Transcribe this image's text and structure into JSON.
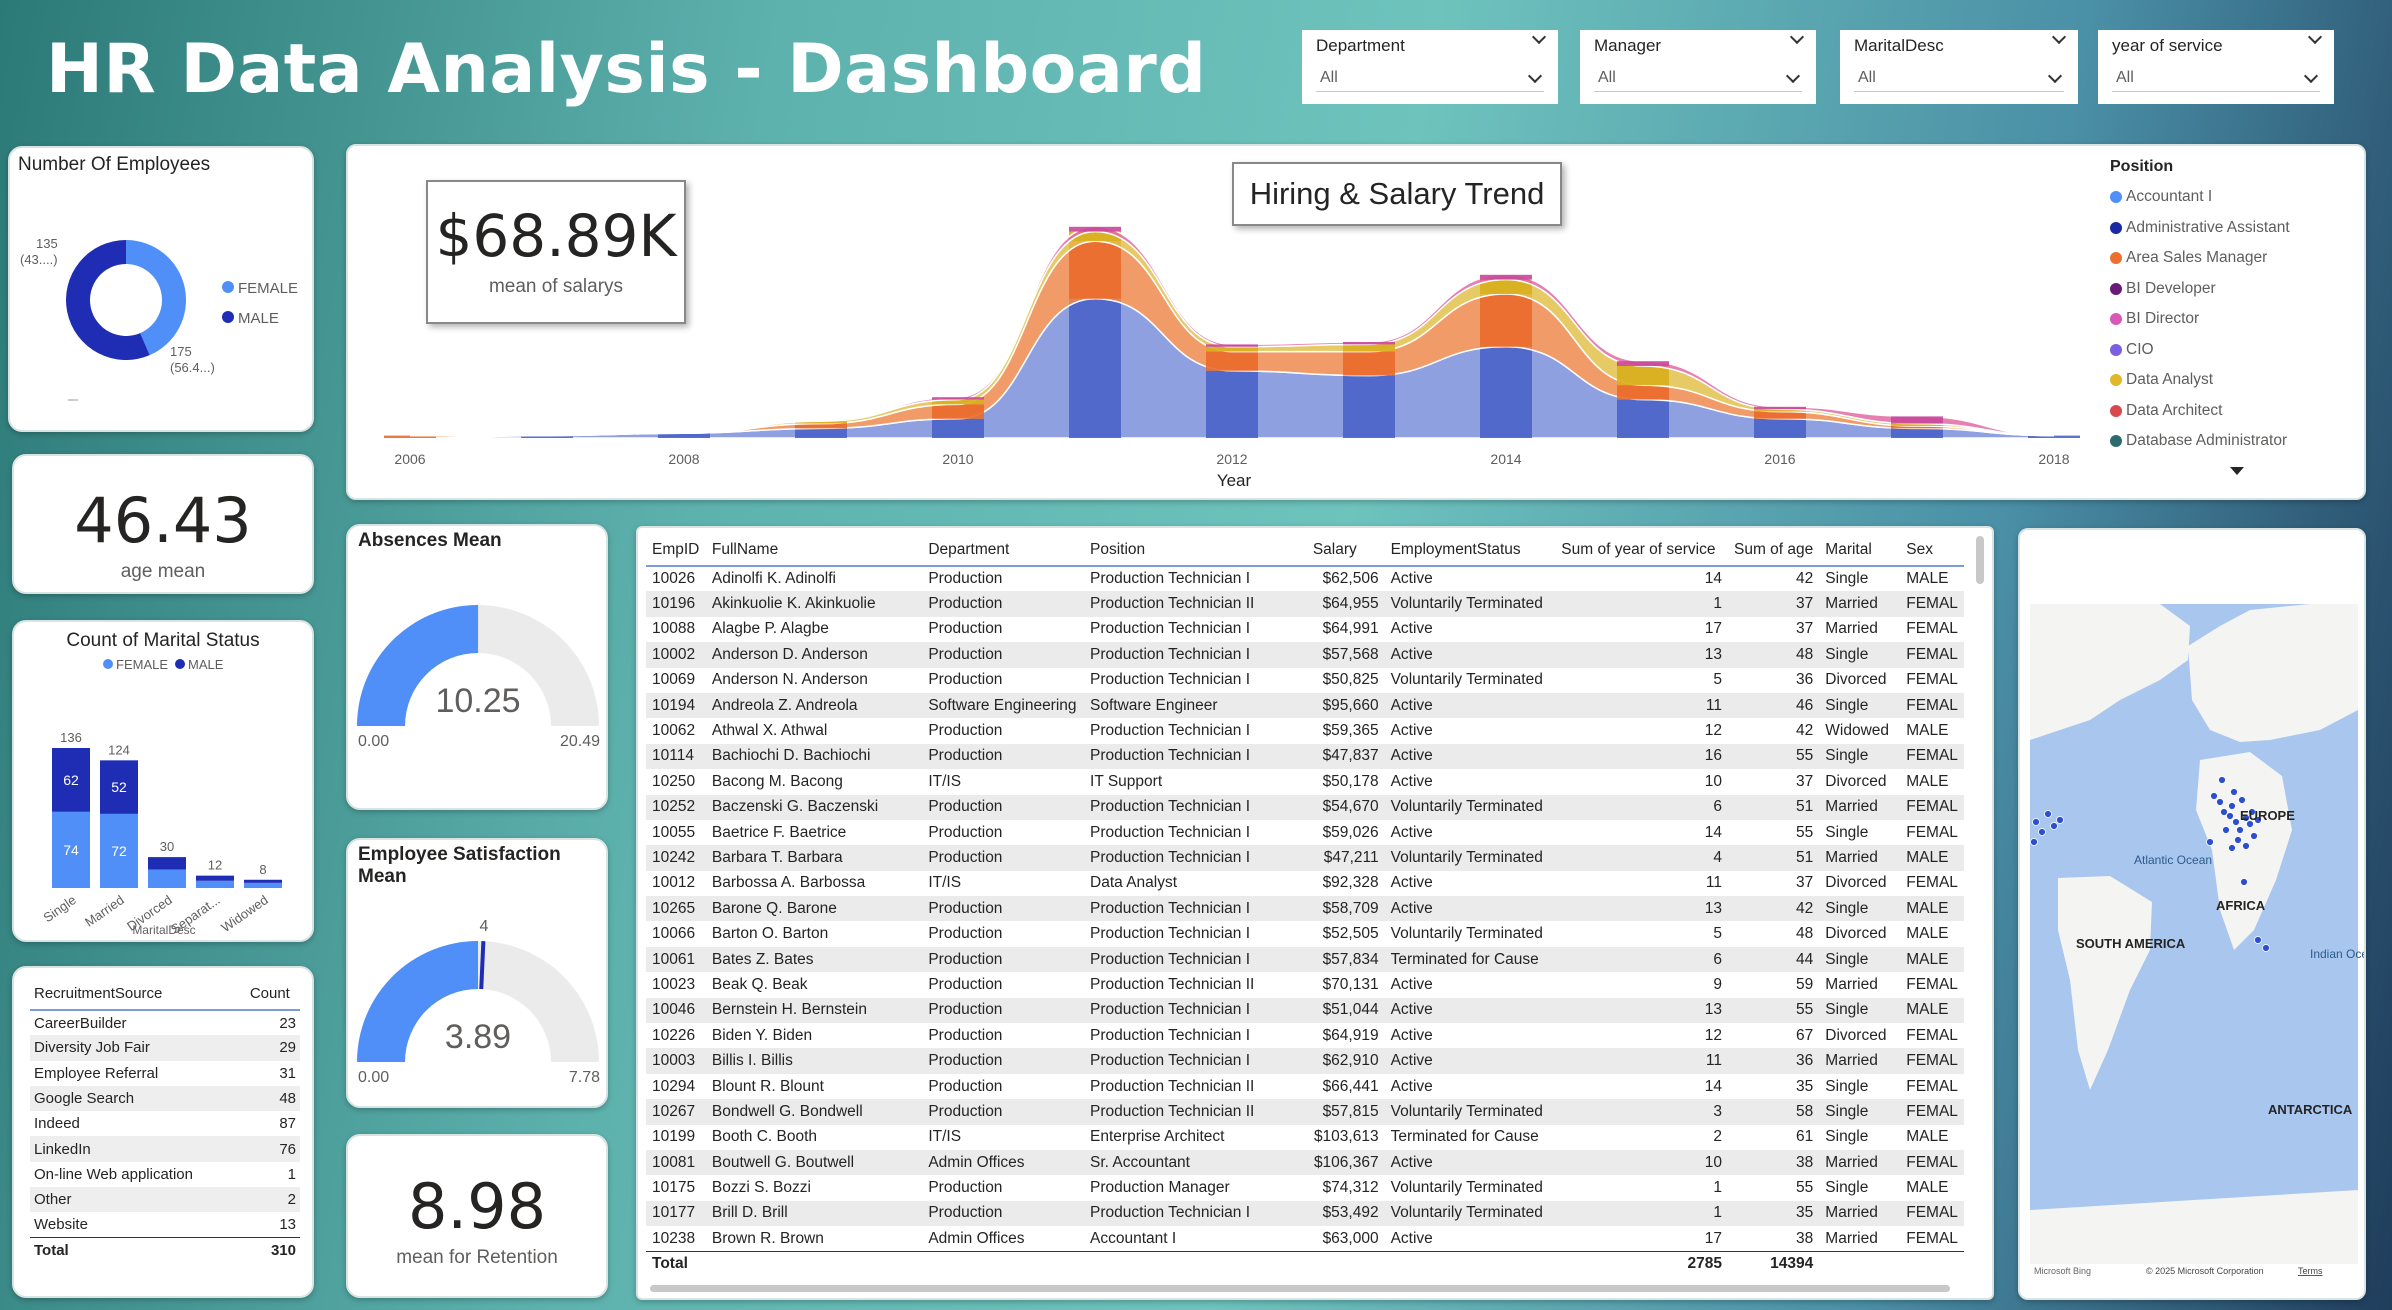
{
  "header": {
    "title": "HR Data Analysis - Dashboard"
  },
  "slicers": [
    {
      "label": "Department",
      "value": "All"
    },
    {
      "label": "Manager",
      "value": "All"
    },
    {
      "label": "MaritalDesc",
      "value": "All"
    },
    {
      "label": "year of service",
      "value": "All"
    }
  ],
  "employees": {
    "title": "Number Of Employees",
    "female_label": "135",
    "female_pct": "(43....)",
    "male_label": "175",
    "male_pct": "(56.4...)",
    "legend_female": "FEMALE",
    "legend_male": "MALE",
    "colors": {
      "female": "#4f8ff7",
      "male": "#1f2db5"
    }
  },
  "age": {
    "value": "46.43",
    "label": "age mean"
  },
  "marital": {
    "title": "Count of Marital Status",
    "legend_female": "FEMALE",
    "legend_male": "MALE",
    "xlabel": "MaritalDesc"
  },
  "recruitment": {
    "headers": [
      "RecruitmentSource",
      "Count"
    ],
    "rows": [
      [
        "CareerBuilder",
        "23"
      ],
      [
        "Diversity Job Fair",
        "29"
      ],
      [
        "Employee Referral",
        "31"
      ],
      [
        "Google Search",
        "48"
      ],
      [
        "Indeed",
        "87"
      ],
      [
        "LinkedIn",
        "76"
      ],
      [
        "On-line Web application",
        "1"
      ],
      [
        "Other",
        "2"
      ],
      [
        "Website",
        "13"
      ]
    ],
    "total_label": "Total",
    "total_value": "310"
  },
  "salary_kpi": {
    "value": "$68.89K",
    "label": "mean of salarys"
  },
  "trend": {
    "title": "Hiring & Salary Trend",
    "xlabel": "Year",
    "legend_title": "Position",
    "legend": [
      {
        "name": "Accountant I",
        "color": "#4f8ff7"
      },
      {
        "name": "Administrative Assistant",
        "color": "#1a2aa0"
      },
      {
        "name": "Area Sales Manager",
        "color": "#ec6f2e"
      },
      {
        "name": "BI Developer",
        "color": "#6a1b7a"
      },
      {
        "name": "BI Director",
        "color": "#d858b8"
      },
      {
        "name": "CIO",
        "color": "#7b5fe0"
      },
      {
        "name": "Data Analyst",
        "color": "#e0b82a"
      },
      {
        "name": "Data Architect",
        "color": "#d9484c"
      },
      {
        "name": "Database Administrator",
        "color": "#2e6b6e"
      }
    ]
  },
  "absences": {
    "title": "Absences Mean",
    "value": "10.25",
    "min": "0.00",
    "max": "20.49"
  },
  "satisfaction": {
    "title": "Employee Satisfaction Mean",
    "value": "3.89",
    "min": "0.00",
    "max": "7.78",
    "target": "4"
  },
  "retention": {
    "value": "8.98",
    "label": "mean for Retention"
  },
  "employee_table": {
    "headers": [
      "EmpID",
      "FullName",
      "Department",
      "Position",
      "Salary",
      "EmploymentStatus",
      "Sum of year of service",
      "Sum of age",
      "Marital",
      "Sex"
    ],
    "rows": [
      [
        "10026",
        "Adinolfi K. Adinolfi",
        "Production",
        "Production Technician I",
        "$62,506",
        "Active",
        "14",
        "42",
        "Single",
        "MALE"
      ],
      [
        "10196",
        "Akinkuolie K. Akinkuolie",
        "Production",
        "Production Technician II",
        "$64,955",
        "Voluntarily Terminated",
        "1",
        "37",
        "Married",
        "FEMAL"
      ],
      [
        "10088",
        "Alagbe P. Alagbe",
        "Production",
        "Production Technician I",
        "$64,991",
        "Active",
        "17",
        "37",
        "Married",
        "FEMAL"
      ],
      [
        "10002",
        "Anderson D. Anderson",
        "Production",
        "Production Technician I",
        "$57,568",
        "Active",
        "13",
        "48",
        "Single",
        "FEMAL"
      ],
      [
        "10069",
        "Anderson N. Anderson",
        "Production",
        "Production Technician I",
        "$50,825",
        "Voluntarily Terminated",
        "5",
        "36",
        "Divorced",
        "FEMAL"
      ],
      [
        "10194",
        "Andreola Z. Andreola",
        "Software Engineering",
        "Software Engineer",
        "$95,660",
        "Active",
        "11",
        "46",
        "Single",
        "FEMAL"
      ],
      [
        "10062",
        "Athwal X. Athwal",
        "Production",
        "Production Technician I",
        "$59,365",
        "Active",
        "12",
        "42",
        "Widowed",
        "MALE"
      ],
      [
        "10114",
        "Bachiochi D. Bachiochi",
        "Production",
        "Production Technician I",
        "$47,837",
        "Active",
        "16",
        "55",
        "Single",
        "FEMAL"
      ],
      [
        "10250",
        "Bacong M. Bacong",
        "IT/IS",
        "IT Support",
        "$50,178",
        "Active",
        "10",
        "37",
        "Divorced",
        "MALE"
      ],
      [
        "10252",
        "Baczenski G. Baczenski",
        "Production",
        "Production Technician I",
        "$54,670",
        "Voluntarily Terminated",
        "6",
        "51",
        "Married",
        "FEMAL"
      ],
      [
        "10055",
        "Baetrice F. Baetrice",
        "Production",
        "Production Technician I",
        "$59,026",
        "Active",
        "14",
        "55",
        "Single",
        "FEMAL"
      ],
      [
        "10242",
        "Barbara T. Barbara",
        "Production",
        "Production Technician I",
        "$47,211",
        "Voluntarily Terminated",
        "4",
        "51",
        "Married",
        "MALE"
      ],
      [
        "10012",
        "Barbossa A. Barbossa",
        "IT/IS",
        "Data Analyst",
        "$92,328",
        "Active",
        "11",
        "37",
        "Divorced",
        "FEMAL"
      ],
      [
        "10265",
        "Barone Q. Barone",
        "Production",
        "Production Technician I",
        "$58,709",
        "Active",
        "13",
        "42",
        "Single",
        "MALE"
      ],
      [
        "10066",
        "Barton O. Barton",
        "Production",
        "Production Technician I",
        "$52,505",
        "Voluntarily Terminated",
        "5",
        "48",
        "Divorced",
        "MALE"
      ],
      [
        "10061",
        "Bates Z. Bates",
        "Production",
        "Production Technician I",
        "$57,834",
        "Terminated for Cause",
        "6",
        "44",
        "Single",
        "MALE"
      ],
      [
        "10023",
        "Beak Q. Beak",
        "Production",
        "Production Technician II",
        "$70,131",
        "Active",
        "9",
        "59",
        "Married",
        "FEMAL"
      ],
      [
        "10046",
        "Bernstein H. Bernstein",
        "Production",
        "Production Technician I",
        "$51,044",
        "Active",
        "13",
        "55",
        "Single",
        "MALE"
      ],
      [
        "10226",
        "Biden Y. Biden",
        "Production",
        "Production Technician I",
        "$64,919",
        "Active",
        "12",
        "67",
        "Divorced",
        "FEMAL"
      ],
      [
        "10003",
        "Billis I. Billis",
        "Production",
        "Production Technician I",
        "$62,910",
        "Active",
        "11",
        "36",
        "Married",
        "FEMAL"
      ],
      [
        "10294",
        "Blount R. Blount",
        "Production",
        "Production Technician II",
        "$66,441",
        "Active",
        "14",
        "35",
        "Single",
        "FEMAL"
      ],
      [
        "10267",
        "Bondwell G. Bondwell",
        "Production",
        "Production Technician II",
        "$57,815",
        "Voluntarily Terminated",
        "3",
        "58",
        "Single",
        "FEMAL"
      ],
      [
        "10199",
        "Booth C. Booth",
        "IT/IS",
        "Enterprise Architect",
        "$103,613",
        "Terminated for Cause",
        "2",
        "61",
        "Single",
        "MALE"
      ],
      [
        "10081",
        "Boutwell G. Boutwell",
        "Admin Offices",
        "Sr. Accountant",
        "$106,367",
        "Active",
        "10",
        "38",
        "Married",
        "FEMAL"
      ],
      [
        "10175",
        "Bozzi S. Bozzi",
        "Production",
        "Production Manager",
        "$74,312",
        "Voluntarily Terminated",
        "1",
        "55",
        "Single",
        "MALE"
      ],
      [
        "10177",
        "Brill D. Brill",
        "Production",
        "Production Technician I",
        "$53,492",
        "Voluntarily Terminated",
        "1",
        "35",
        "Married",
        "FEMAL"
      ],
      [
        "10238",
        "Brown R. Brown",
        "Admin Offices",
        "Accountant I",
        "$63,000",
        "Active",
        "17",
        "38",
        "Married",
        "FEMAL"
      ]
    ],
    "total_label": "Total",
    "total_service": "2785",
    "total_age": "14394"
  },
  "map": {
    "labels": {
      "europe": "EUROPE",
      "atlantic": "Atlantic Ocean",
      "africa": "AFRICA",
      "south_america": "SOUTH AMERICA",
      "indian": "Indian Ocean",
      "antarctica": "ANTARCTICA"
    },
    "footer_brand": "Microsoft Bing",
    "copyright": "© 2025 Microsoft Corporation",
    "terms": "Terms"
  },
  "chart_data": [
    {
      "type": "pie",
      "title": "Number Of Employees",
      "categories": [
        "FEMALE",
        "MALE"
      ],
      "values": [
        135,
        175
      ]
    },
    {
      "type": "bar",
      "title": "Count of Marital Status",
      "xlabel": "MaritalDesc",
      "categories": [
        "Single",
        "Married",
        "Divorced",
        "Separat...",
        "Widowed"
      ],
      "totals": [
        136,
        124,
        30,
        12,
        8
      ],
      "series": [
        {
          "name": "FEMALE",
          "values": [
            74,
            72,
            18,
            7,
            5
          ],
          "color": "#4f8ff7"
        },
        {
          "name": "MALE",
          "values": [
            62,
            52,
            12,
            5,
            3
          ],
          "color": "#1f2db5"
        }
      ]
    },
    {
      "type": "area",
      "title": "Hiring & Salary Trend",
      "xlabel": "Year",
      "x_ticks": [
        "2006",
        "2008",
        "2010",
        "2012",
        "2014",
        "2016",
        "2018"
      ],
      "x": [
        2006,
        2007,
        2008,
        2009,
        2010,
        2011,
        2012,
        2013,
        2014,
        2015,
        2016,
        2017,
        2018
      ],
      "series": [
        {
          "name": "Accountant I",
          "values": [
            0,
            1,
            2,
            4,
            8,
            58,
            28,
            26,
            38,
            16,
            8,
            4,
            1
          ]
        },
        {
          "name": "Area Sales Manager",
          "values": [
            1,
            0,
            0,
            2,
            6,
            24,
            8,
            10,
            22,
            6,
            3,
            1,
            0
          ]
        },
        {
          "name": "Data Analyst",
          "values": [
            0,
            0,
            0,
            1,
            2,
            4,
            2,
            3,
            6,
            8,
            1,
            1,
            0
          ]
        },
        {
          "name": "BI Director",
          "values": [
            0,
            0,
            0,
            0,
            1,
            2,
            1,
            1,
            2,
            2,
            1,
            3,
            0
          ]
        }
      ]
    },
    {
      "type": "gauge",
      "title": "Absences Mean",
      "value": 10.25,
      "min": 0.0,
      "max": 20.49
    },
    {
      "type": "gauge",
      "title": "Employee Satisfaction Mean",
      "value": 3.89,
      "min": 0.0,
      "max": 7.78,
      "target": 4
    }
  ]
}
